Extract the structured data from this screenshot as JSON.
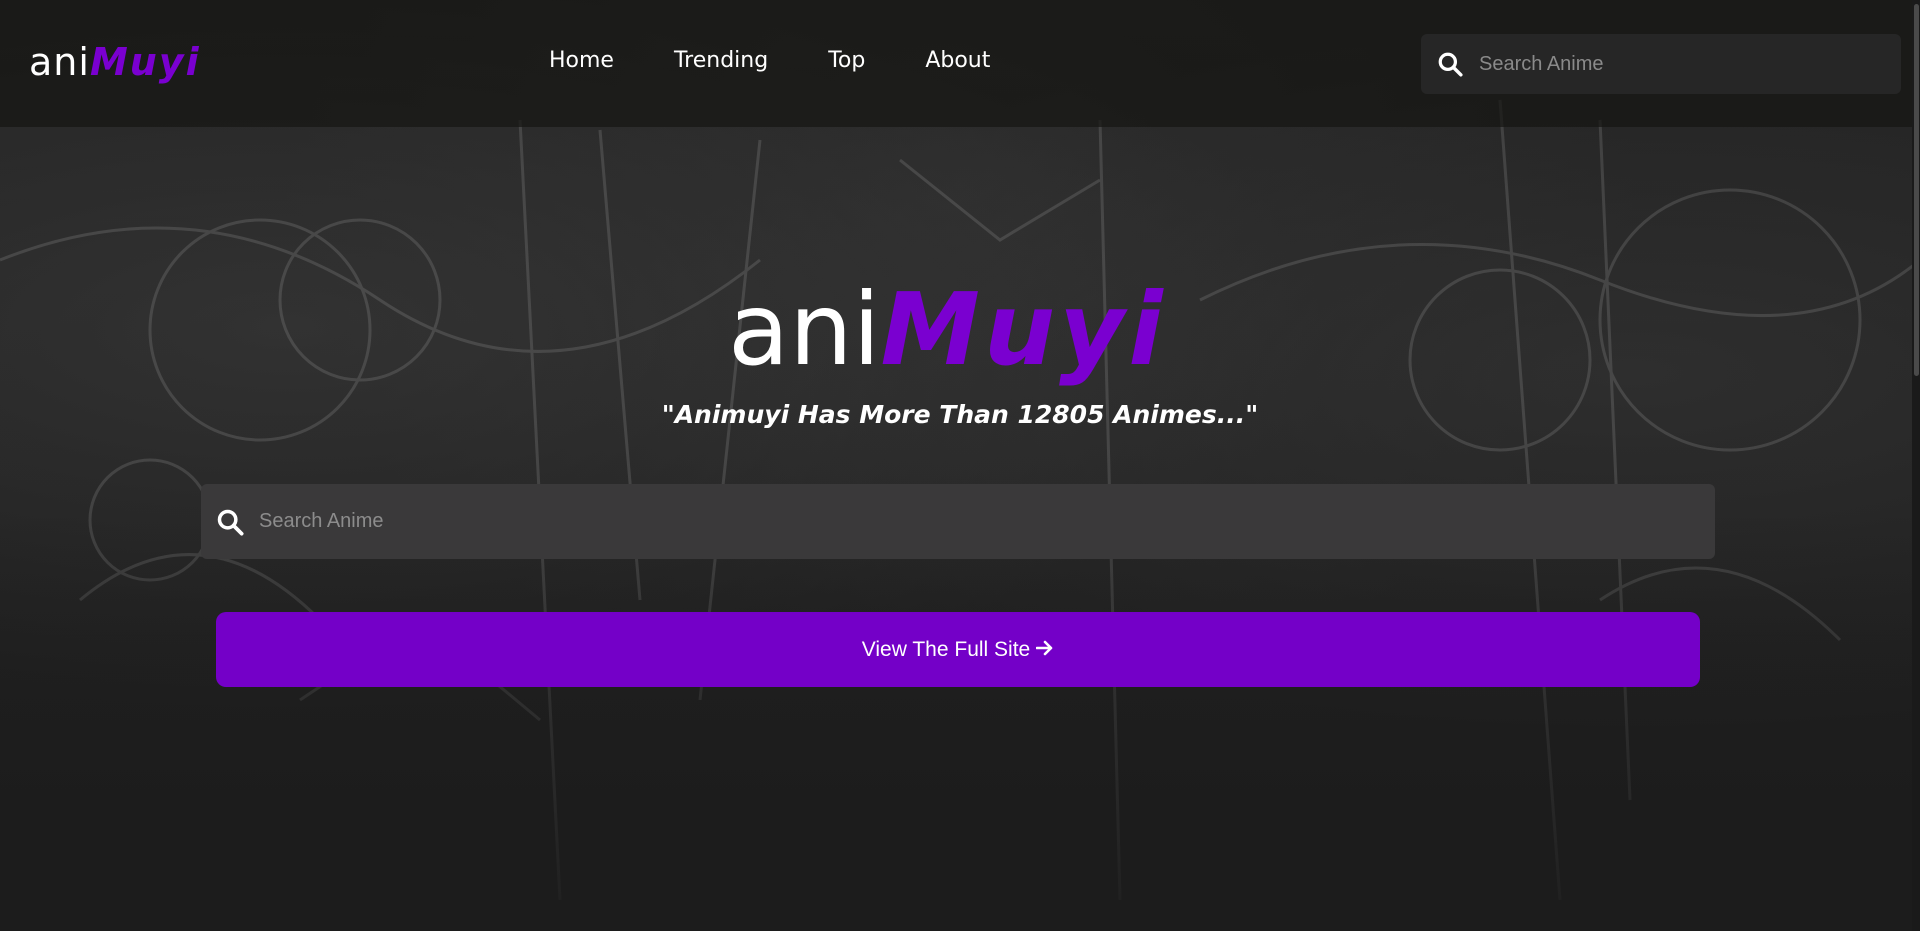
{
  "brand": {
    "name_part1": "ani",
    "name_part2": "Muyi",
    "accent_color": "#7400c8"
  },
  "nav": {
    "links": [
      {
        "label": "Home"
      },
      {
        "label": "Trending"
      },
      {
        "label": "Top"
      },
      {
        "label": "About"
      }
    ],
    "search": {
      "placeholder": "Search Anime",
      "icon": "search-icon"
    }
  },
  "hero": {
    "logo_part1": "ani",
    "logo_part2": "Muyi",
    "tagline": "\"Animuyi Has More Than 12805 Animes...\"",
    "search": {
      "placeholder": "Search Anime",
      "icon": "search-icon"
    },
    "cta": {
      "label": "View The Full Site",
      "icon": "arrow-right-icon"
    }
  }
}
